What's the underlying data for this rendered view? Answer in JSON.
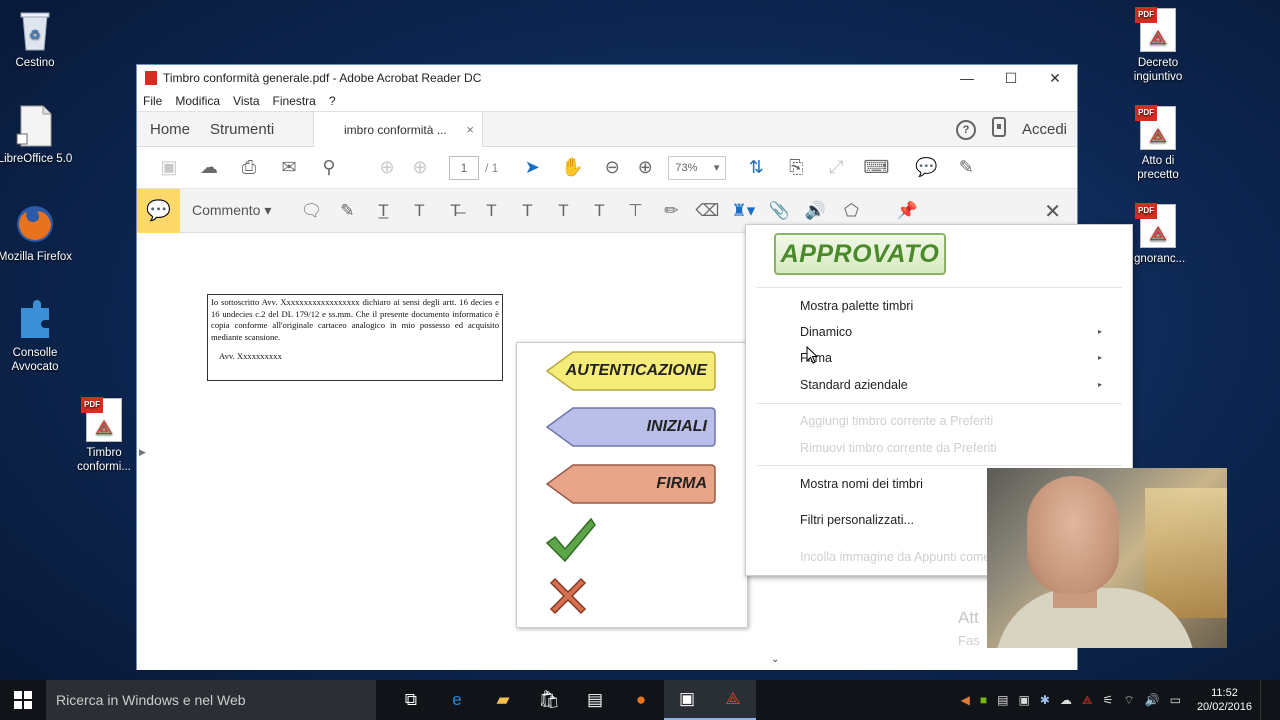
{
  "desktop": {
    "icons_left": [
      {
        "label": "Cestino",
        "icon": "recycle-bin-icon"
      },
      {
        "label": "LibreOffice 5.0",
        "icon": "libreoffice-icon"
      },
      {
        "label": "Mozilla Firefox",
        "icon": "firefox-icon"
      },
      {
        "label": "Consolle Avvocato",
        "icon": "puzzle-icon"
      },
      {
        "label": "Timbro conformi...",
        "icon": "pdf-file-icon"
      }
    ],
    "icons_right": [
      {
        "label": "Decreto ingiuntivo",
        "icon": "pdf-file-icon"
      },
      {
        "label": "Atto di precetto",
        "icon": "pdf-file-icon"
      },
      {
        "label": "Ignoranc...",
        "icon": "pdf-file-icon"
      }
    ],
    "pdf_tag": "PDF"
  },
  "window": {
    "title": "Timbro conformità generale.pdf - Adobe Acrobat Reader DC",
    "controls": {
      "minimize": "—",
      "maximize": "☐",
      "close": "✕"
    },
    "menu": [
      "File",
      "Modifica",
      "Vista",
      "Finestra",
      "?"
    ],
    "tabs": {
      "home": "Home",
      "tools": "Strumenti",
      "document": "imbro conformità ...",
      "close": "×"
    },
    "account": {
      "help": "?",
      "login": "Accedi"
    },
    "page": {
      "current": "1",
      "total": "/ 1"
    },
    "zoom": "73%",
    "comment_label": "Commento"
  },
  "document": {
    "body": "Io sottoscritto Avv.  Xxxxxxxxxxxxxxxxxx dichiaro ai sensi degli artt. 16 decies e 16 undecies c.2 del DL 179/12 e ss.mm. Che il presente documento informatico è copia conforme all'originale cartaceo analogico in mio possesso ed acquisito mediante scansione.",
    "signature": "Avv.  Xxxxxxxxxx"
  },
  "stamp_palette": {
    "stamps": [
      "AUTENTICAZIONE",
      "INIZIALI",
      "FIRMA"
    ],
    "symbols": [
      "check-stamp",
      "cross-stamp"
    ]
  },
  "stamp_menu": {
    "current_stamp": "APPROVATO",
    "items": [
      {
        "label": "Mostra palette timbri",
        "submenu": false,
        "enabled": true
      },
      {
        "label": "Dinamico",
        "submenu": true,
        "enabled": true
      },
      {
        "label": "Firma",
        "submenu": true,
        "enabled": true
      },
      {
        "label": "Standard aziendale",
        "submenu": true,
        "enabled": true
      },
      {
        "label": "Aggiungi timbro corrente a Preferiti",
        "submenu": false,
        "enabled": false
      },
      {
        "label": "Rimuovi timbro corrente da Preferiti",
        "submenu": false,
        "enabled": false
      },
      {
        "label": "Mostra nomi dei timbri",
        "submenu": false,
        "enabled": true
      },
      {
        "label": "Filtri personalizzati...",
        "submenu": false,
        "enabled": true
      },
      {
        "label": "Incolla immagine da Appunti come timbro",
        "submenu": false,
        "enabled": false
      }
    ],
    "arrow": "▸"
  },
  "ghost_text": {
    "line1": "Att",
    "line2": "Fas"
  },
  "taskbar": {
    "search_placeholder": "Ricerca in Windows e nel Web",
    "time": "11:52",
    "date": "20/02/2016"
  },
  "colors": {
    "accent": "#1a6fc4",
    "comment_yellow": "#fdd96b",
    "approved_green": "#4a8a2a",
    "pdf_red": "#d0301f"
  }
}
